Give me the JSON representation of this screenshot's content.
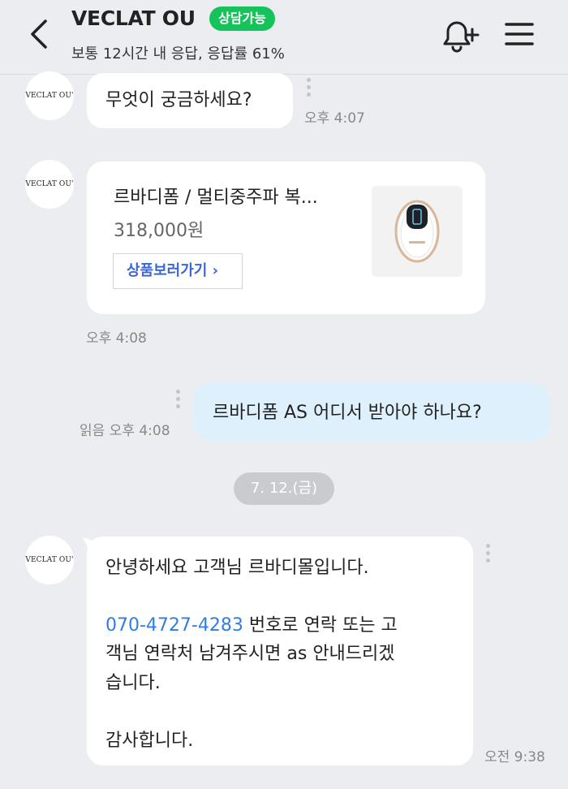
{
  "header": {
    "back_icon": "chevron-left-icon",
    "title": "VECLAT OU",
    "status_badge": "상담가능",
    "subtitle": "보통 12시간 내 응답, 응답률 61%",
    "bell_icon": "bell-plus-icon",
    "menu_icon": "hamburger-menu-icon",
    "accent_color": "#16c35a"
  },
  "avatar_label": "VECLAT OU'",
  "messages": [
    {
      "text": "무엇이 궁금하세요?",
      "time": "오후 4:07"
    },
    {
      "product": {
        "title": "르바디폼 / 멀티중주파 복...",
        "price": "318,000원",
        "button": "상품보러가기 ›"
      },
      "time": "오후 4:08"
    },
    {
      "sent_text": "르바디폼 AS 어디서 받아야 하나요?",
      "read_time": "읽음 오후 4:08"
    }
  ],
  "date_divider": "7. 12.(금)",
  "reply": {
    "line1": "안녕하세요 고객님 르바디몰입니다.",
    "phone": "070-4727-4283",
    "line2_rest": " 번호로 연락 또는 고",
    "line3": "객님 연락처 남겨주시면 as 안내드리겠",
    "line4": "습니다.",
    "line5": "감사합니다.",
    "time": "오전 9:38",
    "phone_color": "#2f7ee0"
  }
}
